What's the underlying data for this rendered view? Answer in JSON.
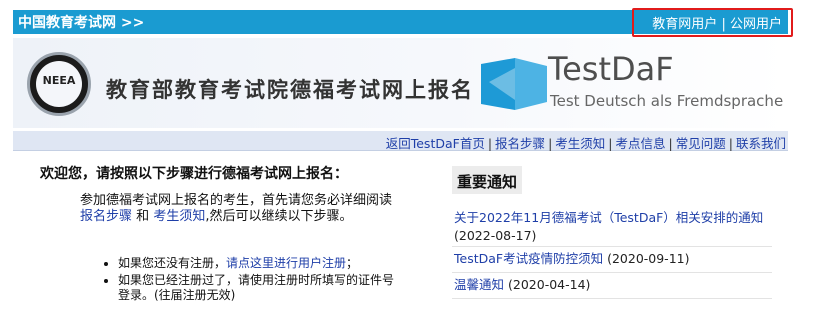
{
  "header": {
    "site_title": "中国教育考试网 >>",
    "user_links": [
      {
        "label": "教育网用户"
      },
      {
        "label": "公网用户"
      }
    ],
    "user_links_separator": "|",
    "highlight_color": "#e11b1b",
    "bar_color": "#1a9bd1"
  },
  "banner": {
    "seal_text": "NEEA",
    "org_title": "教育部教育考试院德福考试网上报名",
    "testdaf_name": "TestDaF",
    "testdaf_subtitle": "Test Deutsch als Fremdsprache",
    "logo_color": "#1e9ad6"
  },
  "nav": {
    "items": [
      {
        "label": "返回TestDaF首页"
      },
      {
        "label": "报名步骤"
      },
      {
        "label": "考生须知"
      },
      {
        "label": "考点信息"
      },
      {
        "label": "常见问题"
      },
      {
        "label": "联系我们"
      }
    ],
    "separator": "|"
  },
  "main": {
    "welcome": "欢迎您，请按照以下步骤进行德福考试网上报名：",
    "intro_prefix": "参加德福考试网上报名的考生，首先请您务必详细阅读",
    "link_steps": "报名步骤",
    "and": "和",
    "link_notice": "考生须知",
    "intro_suffix": ",然后可以继续以下步骤。",
    "step1_prefix": "如果您还没有注册，",
    "step1_link": "请点这里进行用户注册",
    "step1_suffix": "；",
    "step2_text": "如果您已经注册过了，请使用注册时所填写的证件号登录。(往届注册无效)"
  },
  "notices": {
    "heading": "重要通知",
    "items": [
      {
        "title": "关于2022年11月德福考试（TestDaF）相关安排的通知",
        "date": "(2022-08-17)"
      },
      {
        "title": "TestDaF考试疫情防控须知",
        "date": "(2020-09-11)"
      },
      {
        "title": "温馨通知",
        "date": "(2020-04-14)"
      }
    ]
  }
}
